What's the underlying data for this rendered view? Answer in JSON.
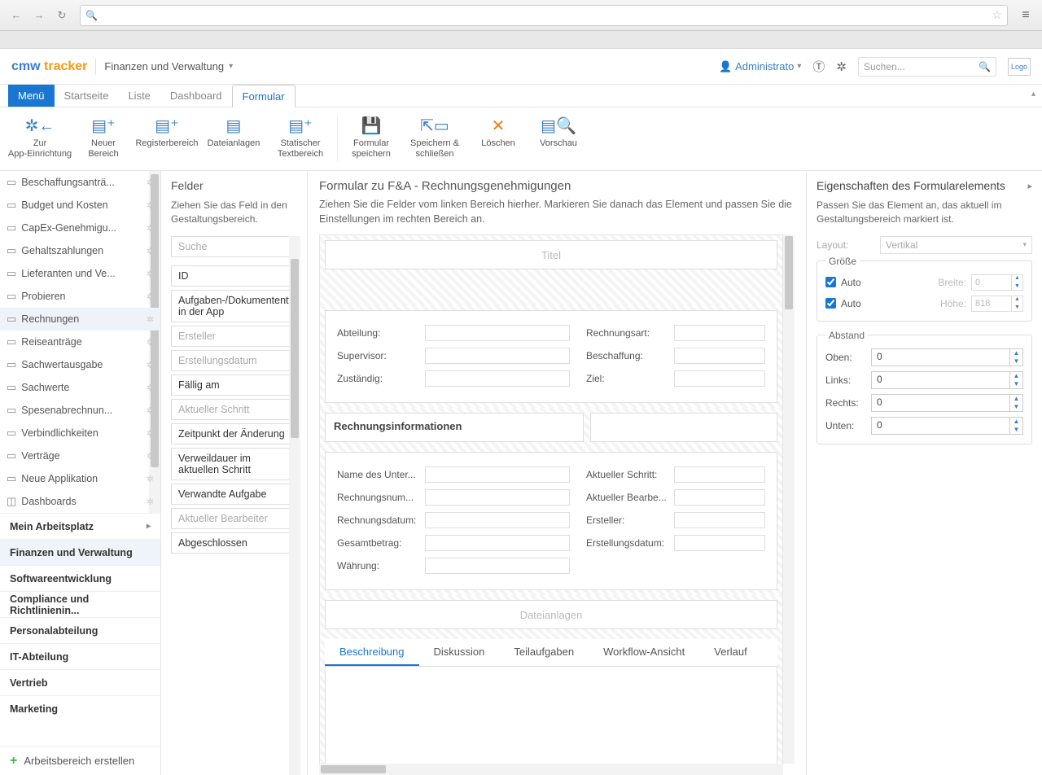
{
  "browser": {
    "star": "☆",
    "menu": "≡"
  },
  "app": {
    "logo1": "cmw ",
    "logo2": "tracker",
    "breadcrumb": "Finanzen und Verwaltung",
    "user": "Administrato",
    "search_placeholder": "Suchen...",
    "logo_box": "Logo"
  },
  "tabs": {
    "menu": "Menü",
    "items": [
      "Startseite",
      "Liste",
      "Dashboard",
      "Formular"
    ],
    "active": "Formular"
  },
  "ribbon": {
    "b0": "Zur\nApp-Einrichtung",
    "b1": "Neuer\nBereich",
    "b2": "Registerbereich",
    "b3": "Dateianlagen",
    "b4": "Statischer\nTextbereich",
    "b5": "Formular\nspeichern",
    "b6": "Speichern &\nschließen",
    "b7": "Löschen",
    "b8": "Vorschau"
  },
  "sidebar": {
    "apps": [
      {
        "label": "Beschaffungsanträ...",
        "sel": false
      },
      {
        "label": "Budget und Kosten",
        "sel": false
      },
      {
        "label": "CapEx-Genehmigu...",
        "sel": false
      },
      {
        "label": "Gehaltszahlungen",
        "sel": false
      },
      {
        "label": "Lieferanten und Ve...",
        "sel": false
      },
      {
        "label": "Probieren",
        "sel": false
      },
      {
        "label": "Rechnungen",
        "sel": true
      },
      {
        "label": "Reiseanträge",
        "sel": false
      },
      {
        "label": "Sachwertausgabe",
        "sel": false
      },
      {
        "label": "Sachwerte",
        "sel": false
      },
      {
        "label": "Spesenabrechnun...",
        "sel": false
      },
      {
        "label": "Verbindlichkeiten",
        "sel": false
      },
      {
        "label": "Verträge",
        "sel": false
      },
      {
        "label": "Neue Applikation",
        "sel": false
      },
      {
        "label": "Dashboards",
        "sel": false
      }
    ],
    "groups": [
      {
        "label": "Mein Arbeitsplatz",
        "active": false,
        "chev": true
      },
      {
        "label": "Finanzen und Verwaltung",
        "active": true,
        "chev": false
      },
      {
        "label": "Softwareentwicklung",
        "active": false,
        "chev": false
      },
      {
        "label": "Compliance und Richtlinienin...",
        "active": false,
        "chev": false
      },
      {
        "label": "Personalabteilung",
        "active": false,
        "chev": false
      },
      {
        "label": "IT-Abteilung",
        "active": false,
        "chev": false
      },
      {
        "label": "Vertrieb",
        "active": false,
        "chev": false
      },
      {
        "label": "Marketing",
        "active": false,
        "chev": false
      }
    ],
    "footer": "Arbeitsbereich erstellen"
  },
  "felder": {
    "title": "Felder",
    "hint": "Ziehen Sie das Feld in den Gestaltungsbereich.",
    "search_placeholder": "Suche",
    "items": [
      {
        "label": "ID",
        "dim": false
      },
      {
        "label": "Aufgaben-/Dokumententyp in der App",
        "dim": false
      },
      {
        "label": "Ersteller",
        "dim": true
      },
      {
        "label": "Erstellungsdatum",
        "dim": true
      },
      {
        "label": "Fällig am",
        "dim": false
      },
      {
        "label": "Aktueller Schritt",
        "dim": true
      },
      {
        "label": "Zeitpunkt der Änderung",
        "dim": false
      },
      {
        "label": "Verweildauer im aktuellen Schritt",
        "dim": false
      },
      {
        "label": "Verwandte Aufgabe",
        "dim": false
      },
      {
        "label": "Aktueller Bearbeiter",
        "dim": true
      },
      {
        "label": "Abgeschlossen",
        "dim": false
      }
    ]
  },
  "design": {
    "title": "Formular zu F&A - Rechnungsgenehmigungen",
    "hint": "Ziehen Sie die Felder vom linken Bereich hierher. Markieren Sie danach das Element und passen Sie die Einstellungen im rechten Bereich an.",
    "titel_placeholder": "Titel",
    "block1_left": [
      "Abteilung:",
      "Supervisor:",
      "Zuständig:"
    ],
    "block1_right": [
      "Rechnungsart:",
      "Beschaffung:",
      "Ziel:"
    ],
    "section_title": "Rechnungsinformationen",
    "block2_left": [
      "Name des Unter...",
      "Rechnungsnum...",
      "Rechnungsdatum:",
      "Gesamtbetrag:",
      "Währung:"
    ],
    "block2_right": [
      "Aktueller Schritt:",
      "Aktueller Bearbe...",
      "Ersteller:",
      "Erstellungsdatum:"
    ],
    "attachments_placeholder": "Dateianlagen",
    "inner_tabs": [
      "Beschreibung",
      "Diskussion",
      "Teilaufgaben",
      "Workflow-Ansicht",
      "Verlauf"
    ],
    "inner_active": "Beschreibung"
  },
  "props": {
    "title": "Eigenschaften des Formularelements",
    "hint": "Passen Sie das Element an, das aktuell im Gestaltungsbereich markiert ist.",
    "layout_label": "Layout:",
    "layout_value": "Vertikal",
    "size_legend": "Größe",
    "auto": "Auto",
    "width_label": "Breite:",
    "width_value": "0",
    "height_label": "Höhe:",
    "height_value": "818",
    "margin_legend": "Abstand",
    "margins": [
      {
        "label": "Oben:",
        "value": "0"
      },
      {
        "label": "Links:",
        "value": "0"
      },
      {
        "label": "Rechts:",
        "value": "0"
      },
      {
        "label": "Unten:",
        "value": "0"
      }
    ]
  }
}
